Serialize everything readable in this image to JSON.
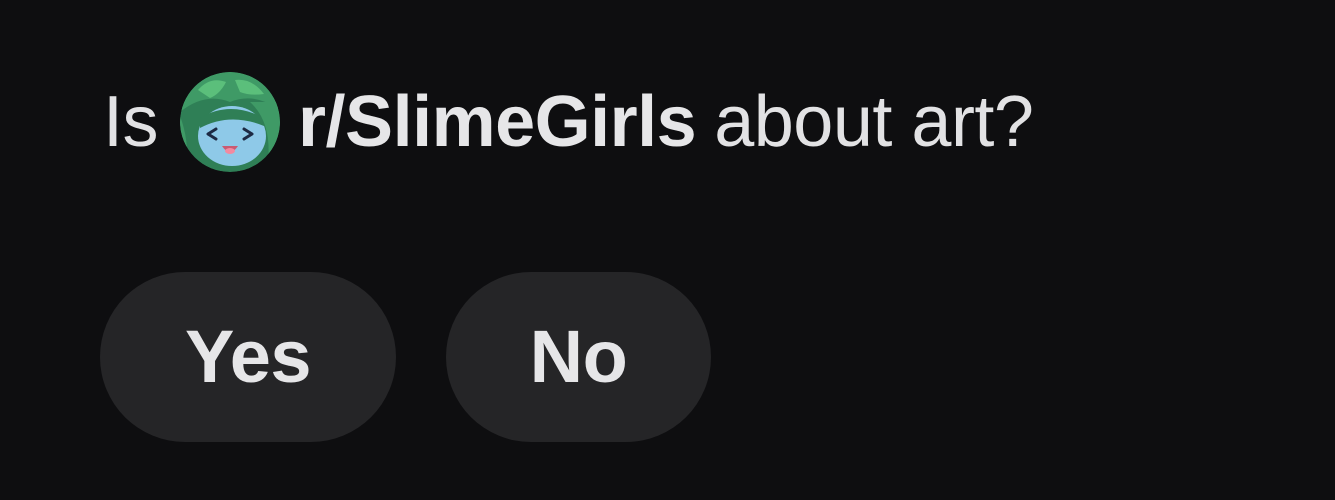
{
  "question": {
    "prefix": "Is",
    "community_name": "r/SlimeGirls",
    "suffix": "about art?",
    "community_icon": "slime-girl-avatar-icon"
  },
  "answers": {
    "yes_label": "Yes",
    "no_label": "No"
  },
  "colors": {
    "background": "#0e0e10",
    "button_background": "#252527",
    "text": "#e3e3e5",
    "avatar_green": "#3a8a5c",
    "avatar_face": "#8ec9e8"
  }
}
